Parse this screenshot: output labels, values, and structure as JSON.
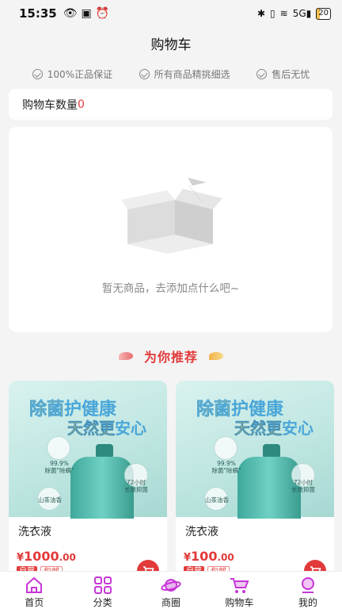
{
  "status": {
    "time": "15:35",
    "battery": "20",
    "network": "5G"
  },
  "header": {
    "title": "购物车"
  },
  "guarantees": [
    {
      "label": "100%正品保证"
    },
    {
      "label": "所有商品精挑细选"
    },
    {
      "label": "售后无忧"
    }
  ],
  "cart": {
    "count_label": "购物车数量",
    "count": "0",
    "empty_text": "暂无商品，去添加点什么吧~"
  },
  "recommend": {
    "title": "为你推荐"
  },
  "products": [
    {
      "name": "洗衣液",
      "price_symbol": "¥",
      "price_int": "1000",
      "price_dec": ".00",
      "banner1": "除菌",
      "banner1b": "护健康",
      "banner2": "天然更",
      "banner2b": "安心",
      "badge1": "99.9%\n除菌\"除螨\"",
      "badge2": "72小时\n长效抑菌",
      "badge3": "山茶油香",
      "tag1": "自营",
      "tag2": "包邮"
    },
    {
      "name": "洗衣液",
      "price_symbol": "¥",
      "price_int": "100",
      "price_dec": ".00",
      "banner1": "除菌",
      "banner1b": "护健康",
      "banner2": "天然更",
      "banner2b": "安心",
      "badge1": "99.9%\n除菌\"除螨\"",
      "badge2": "72小时\n长效抑菌",
      "badge3": "山茶油香",
      "tag1": "自营",
      "tag2": "包邮"
    }
  ],
  "tabs": [
    {
      "label": "首页",
      "icon": "home-icon"
    },
    {
      "label": "分类",
      "icon": "category-icon"
    },
    {
      "label": "商圈",
      "icon": "planet-icon"
    },
    {
      "label": "购物车",
      "icon": "cart-icon"
    },
    {
      "label": "我的",
      "icon": "profile-icon"
    }
  ],
  "colors": {
    "accent": "#e23a3a",
    "tab_accent": "#c636d6"
  }
}
